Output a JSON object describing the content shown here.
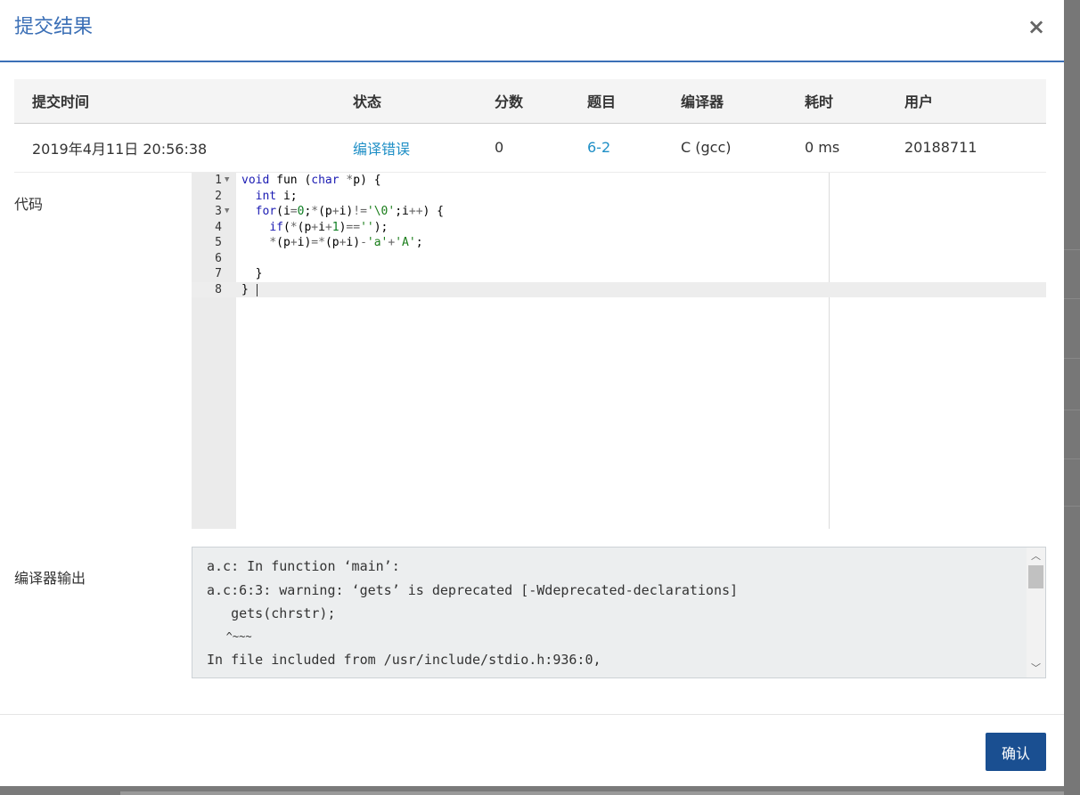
{
  "modal": {
    "title": "提交结果",
    "close_label": "×",
    "confirm_label": "确认"
  },
  "table": {
    "headers": [
      "提交时间",
      "状态",
      "分数",
      "题目",
      "编译器",
      "耗时",
      "用户"
    ],
    "row": {
      "submit_time": "2019年4月11日 20:56:38",
      "status": "编译错误",
      "score": "0",
      "problem": "6-2",
      "compiler": "C (gcc)",
      "time": "0 ms",
      "user": "20188711"
    }
  },
  "code": {
    "label": "代码",
    "line_numbers": [
      "1",
      "2",
      "3",
      "4",
      "5",
      "6",
      "7",
      "8"
    ]
  },
  "compiler_output": {
    "label": "编译器输出",
    "lines": [
      "a.c: In function ‘main’:",
      "a.c:6:3: warning: ‘gets’ is deprecated [-Wdeprecated-declarations]",
      "   gets(chrstr);",
      "   ^~~~",
      "In file included from /usr/include/stdio.h:936:0,"
    ]
  },
  "colors": {
    "accent": "#3b6fb6",
    "link": "#1f8fc6",
    "button": "#1a4f91"
  }
}
